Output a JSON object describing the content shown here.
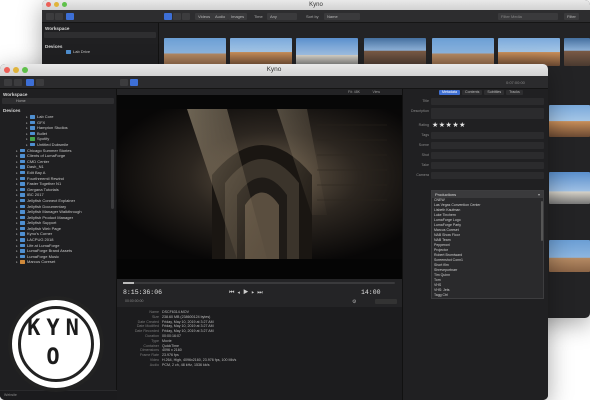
{
  "back_window": {
    "title": "Kyno",
    "toolbar": {
      "filter_videos": "Videos",
      "filter_audio": "Audio",
      "filter_images": "Images",
      "filter_time_label": "Time",
      "filter_time_value": "Any",
      "sort_label": "Sort by",
      "sort_value": "Name",
      "search_placeholder": "Filter Media",
      "filter_button": "Filter"
    },
    "sidebar": {
      "workspace_label": "Workspace",
      "devices_label": "Devices",
      "device_item": "Lab Drive"
    }
  },
  "front_window": {
    "title": "Kyno",
    "timecode_right": "0:07:00:00",
    "sidebar": {
      "workspace_label": "Workspace",
      "workspace_item": "Home",
      "devices_label": "Devices",
      "tree": [
        {
          "label": "Lab Core",
          "color": "blue"
        },
        {
          "label": "GFX",
          "color": "blue"
        },
        {
          "label": "Hampton Studios",
          "color": "blue"
        },
        {
          "label": "Bullet",
          "color": "blue"
        },
        {
          "label": "Spotify",
          "color": "green"
        },
        {
          "label": "Untitled Dubsmile",
          "color": "blue"
        },
        {
          "label": "Chicago Summer Stories",
          "color": "blue"
        },
        {
          "label": "Clients of LumaForge",
          "color": "blue"
        },
        {
          "label": "CMD Center",
          "color": "blue"
        },
        {
          "label": "Dash_N1",
          "color": "blue"
        },
        {
          "label": "Edit Bay A",
          "color": "blue"
        },
        {
          "label": "Fourthreemil Rewind",
          "color": "blue"
        },
        {
          "label": "Faster Together N1",
          "color": "blue"
        },
        {
          "label": "Gergana Tutorials",
          "color": "blue"
        },
        {
          "label": "IBC 2017",
          "color": "blue"
        },
        {
          "label": "Jellyfish Connect Explainer",
          "color": "blue"
        },
        {
          "label": "Jellyfish Documentary",
          "color": "blue"
        },
        {
          "label": "Jellyfish Manager Walkthrough",
          "color": "blue"
        },
        {
          "label": "Jellyfish Product Manager",
          "color": "blue"
        },
        {
          "label": "Jellyfish Support",
          "color": "blue"
        },
        {
          "label": "Jellyfish Web Page",
          "color": "blue"
        },
        {
          "label": "Kyno's Corner",
          "color": "blue"
        },
        {
          "label": "LACPUG 2018",
          "color": "blue"
        },
        {
          "label": "Life at LumaForge",
          "color": "blue"
        },
        {
          "label": "LumaForge Brand Assets",
          "color": "blue"
        },
        {
          "label": "LumaForge Music",
          "color": "blue"
        },
        {
          "label": "Marcus Coreset",
          "color": "orange"
        }
      ],
      "bottom_label": "Website"
    },
    "viewer": {
      "fit_label": "Fit: 48K",
      "view_label": "View",
      "timecode_left": "8:15:36:06",
      "timecode_right": "14:00",
      "duration": "00:00:00:00"
    },
    "metadata_rows": [
      {
        "key": "Name",
        "value": "DSCF6314.MOV"
      },
      {
        "key": "Size",
        "value": "238.60 MB (238600124 bytes)"
      },
      {
        "key": "Date Created",
        "value": "Friday, May 10, 2019 at 3:27 AM"
      },
      {
        "key": "Date Modified",
        "value": "Friday, May 10, 2019 at 3:27 AM"
      },
      {
        "key": "Date Recorded",
        "value": "Friday, May 10, 2019 at 3:27 AM"
      },
      {
        "key": "Duration",
        "value": "00:00:16:07"
      },
      {
        "key": "Type",
        "value": "Movie"
      },
      {
        "key": "Container",
        "value": "QuickTime"
      },
      {
        "key": "Dimensions",
        "value": "4096 x 2160"
      },
      {
        "key": "Frame Rate",
        "value": "23.976 fps"
      },
      {
        "key": "Video",
        "value": "H.264, High, 4096x2160, 23.976 fps, 100 Mb/s"
      },
      {
        "key": "Audio",
        "value": "PCM, 2 ch, 48 kHz, 1536 kb/s"
      }
    ],
    "metadata_panel": {
      "tabs": [
        "Metadata",
        "Contents",
        "Subtitles",
        "Tracks"
      ],
      "active_tab": "Metadata",
      "fields": [
        "Title",
        "Description",
        "Rating",
        "Tags",
        "Scene",
        "Shot",
        "Take",
        "Camera"
      ],
      "rating_stars": "★★★★★",
      "tags_selected": "Productions",
      "tag_options": [
        "CNEW",
        "Las Vegas Convention Center",
        "Lisbeth Kaufman",
        "Luke Tinchern",
        "LumaForge Logo",
        "LumaForge Party",
        "Marcus Coreset",
        "NAB Show Floor",
        "NAB Team",
        "Pepperoni",
        "Projector",
        "Robert Bromiward",
        "Screenshot Conn1",
        "Short film",
        "Shreveportnarr",
        "Tim Quinn",
        "Tom",
        "VHS",
        "VHS: Jets",
        "Tagg Ctrl"
      ]
    }
  },
  "logo": {
    "row1": "KYN",
    "row2": "O"
  }
}
